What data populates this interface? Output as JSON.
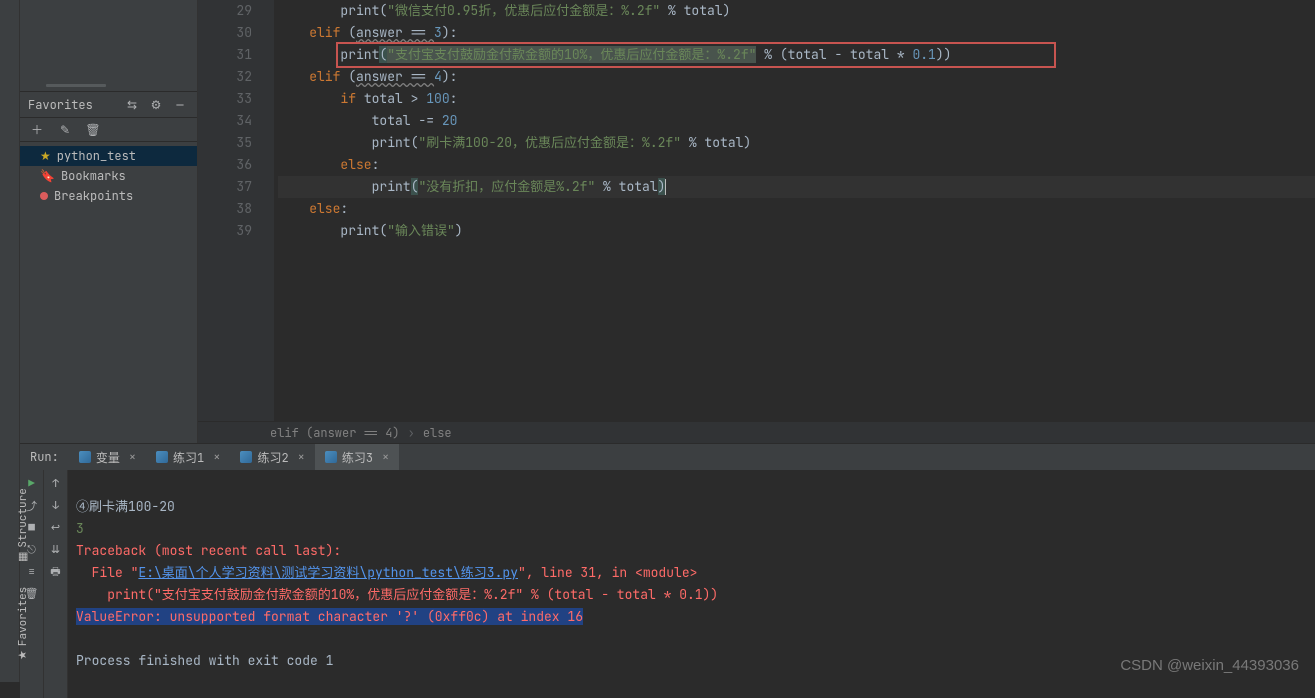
{
  "favorites": {
    "title": "Favorites",
    "items": [
      {
        "label": "python_test",
        "icon": "star"
      },
      {
        "label": "Bookmarks",
        "icon": "bookmark"
      },
      {
        "label": "Breakpoints",
        "icon": "breakpoint"
      }
    ]
  },
  "editor": {
    "lines": [
      {
        "n": 29,
        "indent": 8,
        "tokens": [
          [
            "fn",
            "print("
          ],
          [
            "s",
            "\"微信支付0.95折，优惠后应付金额是：%.2f\""
          ],
          [
            "fn",
            " % total)"
          ]
        ]
      },
      {
        "n": 30,
        "indent": 4,
        "tokens": [
          [
            "k",
            "elif "
          ],
          [
            "fn",
            "("
          ],
          [
            "ksp",
            "answer == "
          ],
          [
            "n",
            "3"
          ],
          [
            "fn",
            "):"
          ]
        ]
      },
      {
        "n": 31,
        "indent": 8,
        "tokens": [
          [
            "fn",
            "print"
          ],
          [
            "brm",
            "("
          ],
          [
            "sdim",
            "\"支付宝支付鼓励金付款金额的10%，优惠后应付金额是：%.2f\""
          ],
          [
            "fn",
            " % (total - total * "
          ],
          [
            "n",
            "0.1"
          ],
          [
            "fn",
            "))"
          ]
        ],
        "hl": true
      },
      {
        "n": 32,
        "indent": 4,
        "tokens": [
          [
            "k",
            "elif "
          ],
          [
            "fn",
            "("
          ],
          [
            "ksp",
            "answer == "
          ],
          [
            "n",
            "4"
          ],
          [
            "fn",
            "):"
          ]
        ]
      },
      {
        "n": 33,
        "indent": 8,
        "tokens": [
          [
            "k",
            "if "
          ],
          [
            "fn",
            "total > "
          ],
          [
            "n",
            "100"
          ],
          [
            "fn",
            ":"
          ]
        ]
      },
      {
        "n": 34,
        "indent": 12,
        "tokens": [
          [
            "fn",
            "total -= "
          ],
          [
            "n",
            "20"
          ]
        ]
      },
      {
        "n": 35,
        "indent": 12,
        "tokens": [
          [
            "fn",
            "print("
          ],
          [
            "s",
            "\"刷卡满100-20，优惠后应付金额是：%.2f\""
          ],
          [
            "fn",
            " % total)"
          ]
        ]
      },
      {
        "n": 36,
        "indent": 8,
        "tokens": [
          [
            "k",
            "else"
          ],
          [
            "fn",
            ":"
          ]
        ]
      },
      {
        "n": 37,
        "indent": 12,
        "tokens": [
          [
            "fn",
            "print"
          ],
          [
            "brm",
            "("
          ],
          [
            "s",
            "\"没有折扣，应付金额是%.2f\""
          ],
          [
            "fn",
            " % total"
          ],
          [
            "brm",
            ")"
          ]
        ],
        "cursor": true,
        "hlrow": true
      },
      {
        "n": 38,
        "indent": 4,
        "tokens": [
          [
            "k",
            "else"
          ],
          [
            "fn",
            ":"
          ]
        ]
      },
      {
        "n": 39,
        "indent": 8,
        "tokens": [
          [
            "fn",
            "print("
          ],
          [
            "s",
            "\"输入错误\""
          ],
          [
            "fnu",
            ")"
          ]
        ]
      }
    ]
  },
  "breadcrumb": {
    "parts": [
      "elif (answer == 4)",
      "else"
    ]
  },
  "run": {
    "label": "Run:",
    "tabs": [
      {
        "label": "变量",
        "active": false
      },
      {
        "label": "练习1",
        "active": false
      },
      {
        "label": "练习2",
        "active": false
      },
      {
        "label": "练习3",
        "active": true
      }
    ],
    "console": {
      "l0": "④刷卡满100-20",
      "l1": "3",
      "l2": "Traceback (most recent call last):",
      "l3_a": "  File \"",
      "l3_link": "E:\\桌面\\个人学习资料\\测试学习资料\\python_test\\练习3.py",
      "l3_b": "\", line 31, in <module>",
      "l4": "    print(\"支付宝支付鼓励金付款金额的10%，优惠后应付金额是：%.2f\" % (total - total * 0.1))",
      "l5": "ValueError: unsupported format character '?' (0xff0c) at index 16",
      "l7": "Process finished with exit code 1"
    }
  },
  "rails": {
    "structure": "Structure",
    "favorites": "Favorites"
  },
  "watermark": "CSDN @weixin_44393036"
}
